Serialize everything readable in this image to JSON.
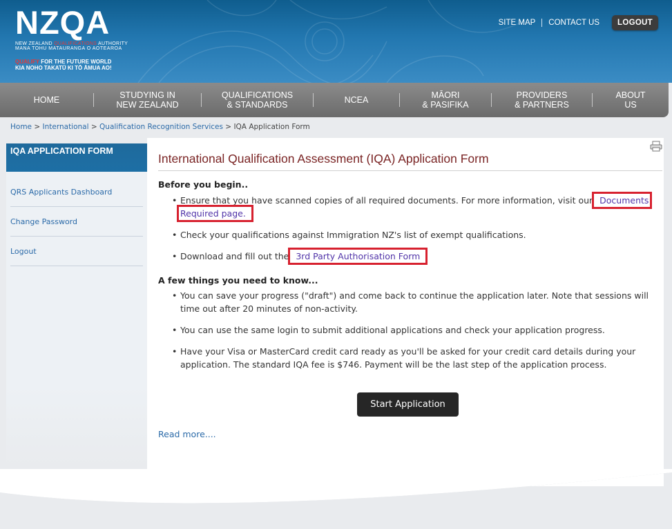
{
  "header": {
    "logo_text": "NZQA",
    "logo_sub1_pre": "NEW ZEALAND ",
    "logo_sub1_red": "QUALIFICATIONS",
    "logo_sub1_post": " AUTHORITY",
    "logo_sub2": "MANA TOHU MATAURANGA O AOTEAROA",
    "tag1_red": "QUALIFY",
    "tag1_rest": " FOR THE FUTURE WORLD",
    "tag2": "KIA NOHO TAKATŪ KI TŌ ĀMUA AO!",
    "links": [
      "SITE MAP",
      "CONTACT US"
    ],
    "logout": "LOGOUT"
  },
  "nav": [
    {
      "line1": "HOME",
      "line2": ""
    },
    {
      "line1": "STUDYING IN",
      "line2": "NEW ZEALAND"
    },
    {
      "line1": "QUALIFICATIONS",
      "line2": "& STANDARDS"
    },
    {
      "line1": "NCEA",
      "line2": ""
    },
    {
      "line1": "MĀORI",
      "line2": "& PASIFIKA"
    },
    {
      "line1": "PROVIDERS",
      "line2": "& PARTNERS"
    },
    {
      "line1": "ABOUT",
      "line2": "US"
    }
  ],
  "breadcrumb": {
    "items": [
      "Home",
      "International",
      "Qualification Recognition Services"
    ],
    "current": "IQA Application Form",
    "separator": ">"
  },
  "sidebar": {
    "title": "IQA APPLICATION FORM",
    "items": [
      "QRS Applicants Dashboard",
      "Change Password",
      "Logout"
    ]
  },
  "main": {
    "title": "International Qualification Assessment (IQA) Application Form",
    "before_heading": "Before you begin..",
    "b1_text": "Ensure that you have scanned copies of all required documents. For more information, visit our ",
    "b1_link": "Documents Required page.",
    "b2_text": "Check your qualifications against Immigration NZ's list of exempt qualifications.",
    "b3_text": "Download and fill out the ",
    "b3_link": "3rd Party Authorisation Form",
    "know_heading": "A few things you need to know...",
    "k1": "You can save your progress (\"draft\") and come back to continue the application later. Note that sessions will time out after 20 minutes of non-activity.",
    "k2": "You can use the same login to submit additional applications and check your application progress.",
    "k3": "Have your Visa or MasterCard credit card ready as you'll be asked for your credit card details during your application. The standard IQA fee is $746. Payment will be the last step of the application process.",
    "start_button": "Start Application",
    "read_more": "Read more...."
  },
  "colors": {
    "header_blue": "#1d6fa5",
    "title_maroon": "#7a2424",
    "link_blue": "#2b6aa8",
    "highlight_red": "#d7212f"
  }
}
